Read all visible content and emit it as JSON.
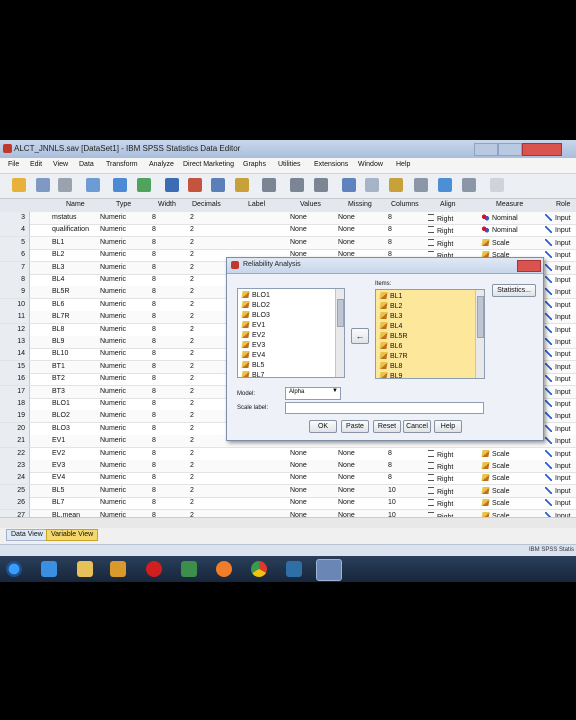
{
  "window": {
    "title": "ALCT_JNNLS.sav [DataSet1] - IBM SPSS Statistics Data Editor"
  },
  "menu": [
    "File",
    "Edit",
    "View",
    "Data",
    "Transform",
    "Analyze",
    "Direct Marketing",
    "Graphs",
    "Utilities",
    "Extensions",
    "Window",
    "Help"
  ],
  "grid": {
    "headers": {
      "name": "Name",
      "type": "Type",
      "width": "Width",
      "decimals": "Decimals",
      "label": "Label",
      "values": "Values",
      "missing": "Missing",
      "columns": "Columns",
      "align": "Align",
      "measure": "Measure",
      "role": "Role"
    },
    "rows": [
      {
        "n": "3",
        "name": "mstatus",
        "type": "Numeric",
        "width": "8",
        "dec": "2",
        "values": "None",
        "missing": "None",
        "columns": "8",
        "align": "Right",
        "measure": "Nominal",
        "role": "Input"
      },
      {
        "n": "4",
        "name": "qualification",
        "type": "Numeric",
        "width": "8",
        "dec": "2",
        "values": "None",
        "missing": "None",
        "columns": "8",
        "align": "Right",
        "measure": "Nominal",
        "role": "Input"
      },
      {
        "n": "5",
        "name": "BL1",
        "type": "Numeric",
        "width": "8",
        "dec": "2",
        "values": "None",
        "missing": "None",
        "columns": "8",
        "align": "Right",
        "measure": "Scale",
        "role": "Input"
      },
      {
        "n": "6",
        "name": "BL2",
        "type": "Numeric",
        "width": "8",
        "dec": "2",
        "values": "None",
        "missing": "None",
        "columns": "8",
        "align": "Right",
        "measure": "Scale",
        "role": "Input"
      },
      {
        "n": "7",
        "name": "BL3",
        "type": "Numeric",
        "width": "8",
        "dec": "2",
        "values": "",
        "missing": "",
        "columns": "",
        "align": "",
        "measure": "",
        "role": "Input"
      },
      {
        "n": "8",
        "name": "BL4",
        "type": "Numeric",
        "width": "8",
        "dec": "2",
        "values": "",
        "missing": "",
        "columns": "",
        "align": "",
        "measure": "",
        "role": "Input"
      },
      {
        "n": "9",
        "name": "BL5R",
        "type": "Numeric",
        "width": "8",
        "dec": "2",
        "values": "",
        "missing": "",
        "columns": "",
        "align": "",
        "measure": "",
        "role": "Input"
      },
      {
        "n": "10",
        "name": "BL6",
        "type": "Numeric",
        "width": "8",
        "dec": "2",
        "values": "",
        "missing": "",
        "columns": "",
        "align": "",
        "measure": "",
        "role": "Input"
      },
      {
        "n": "11",
        "name": "BL7R",
        "type": "Numeric",
        "width": "8",
        "dec": "2",
        "values": "",
        "missing": "",
        "columns": "",
        "align": "",
        "measure": "",
        "role": "Input"
      },
      {
        "n": "12",
        "name": "BL8",
        "type": "Numeric",
        "width": "8",
        "dec": "2",
        "values": "",
        "missing": "",
        "columns": "",
        "align": "",
        "measure": "",
        "role": "Input"
      },
      {
        "n": "13",
        "name": "BL9",
        "type": "Numeric",
        "width": "8",
        "dec": "2",
        "values": "",
        "missing": "",
        "columns": "",
        "align": "",
        "measure": "",
        "role": "Input"
      },
      {
        "n": "14",
        "name": "BL10",
        "type": "Numeric",
        "width": "8",
        "dec": "2",
        "values": "",
        "missing": "",
        "columns": "",
        "align": "",
        "measure": "",
        "role": "Input"
      },
      {
        "n": "15",
        "name": "BT1",
        "type": "Numeric",
        "width": "8",
        "dec": "2",
        "values": "",
        "missing": "",
        "columns": "",
        "align": "",
        "measure": "",
        "role": "Input"
      },
      {
        "n": "16",
        "name": "BT2",
        "type": "Numeric",
        "width": "8",
        "dec": "2",
        "values": "",
        "missing": "",
        "columns": "",
        "align": "",
        "measure": "",
        "role": "Input"
      },
      {
        "n": "17",
        "name": "BT3",
        "type": "Numeric",
        "width": "8",
        "dec": "2",
        "values": "",
        "missing": "",
        "columns": "",
        "align": "",
        "measure": "",
        "role": "Input"
      },
      {
        "n": "18",
        "name": "BLO1",
        "type": "Numeric",
        "width": "8",
        "dec": "2",
        "values": "",
        "missing": "",
        "columns": "",
        "align": "",
        "measure": "",
        "role": "Input"
      },
      {
        "n": "19",
        "name": "BLO2",
        "type": "Numeric",
        "width": "8",
        "dec": "2",
        "values": "",
        "missing": "",
        "columns": "",
        "align": "",
        "measure": "",
        "role": "Input"
      },
      {
        "n": "20",
        "name": "BLO3",
        "type": "Numeric",
        "width": "8",
        "dec": "2",
        "values": "",
        "missing": "",
        "columns": "",
        "align": "",
        "measure": "",
        "role": "Input"
      },
      {
        "n": "21",
        "name": "EV1",
        "type": "Numeric",
        "width": "8",
        "dec": "2",
        "values": "",
        "missing": "",
        "columns": "",
        "align": "",
        "measure": "",
        "role": "Input"
      },
      {
        "n": "22",
        "name": "EV2",
        "type": "Numeric",
        "width": "8",
        "dec": "2",
        "values": "None",
        "missing": "None",
        "columns": "8",
        "align": "Right",
        "measure": "Scale",
        "role": "Input"
      },
      {
        "n": "23",
        "name": "EV3",
        "type": "Numeric",
        "width": "8",
        "dec": "2",
        "values": "None",
        "missing": "None",
        "columns": "8",
        "align": "Right",
        "measure": "Scale",
        "role": "Input"
      },
      {
        "n": "24",
        "name": "EV4",
        "type": "Numeric",
        "width": "8",
        "dec": "2",
        "values": "None",
        "missing": "None",
        "columns": "8",
        "align": "Right",
        "measure": "Scale",
        "role": "Input"
      },
      {
        "n": "25",
        "name": "BL5",
        "type": "Numeric",
        "width": "8",
        "dec": "2",
        "values": "None",
        "missing": "None",
        "columns": "10",
        "align": "Right",
        "measure": "Scale",
        "role": "Input"
      },
      {
        "n": "26",
        "name": "BL7",
        "type": "Numeric",
        "width": "8",
        "dec": "2",
        "values": "None",
        "missing": "None",
        "columns": "10",
        "align": "Right",
        "measure": "Scale",
        "role": "Input"
      },
      {
        "n": "27",
        "name": "BL.mean",
        "type": "Numeric",
        "width": "8",
        "dec": "2",
        "values": "None",
        "missing": "None",
        "columns": "10",
        "align": "Right",
        "measure": "Scale",
        "role": "Input"
      }
    ]
  },
  "tabs": {
    "data_view": "Data View",
    "variable_view": "Variable View"
  },
  "status": "IBM SPSS Statis",
  "dialog": {
    "title": "Reliability Analysis",
    "source_items": [
      "BLO1",
      "BLO2",
      "BLO3",
      "EV1",
      "EV2",
      "EV3",
      "EV4",
      "BL5",
      "BL7"
    ],
    "items_label": "Items:",
    "selected_items": [
      "BL1",
      "BL2",
      "BL3",
      "BL4",
      "BL5R",
      "BL6",
      "BL7R",
      "BL8",
      "BL9"
    ],
    "statistics_button": "Statistics...",
    "model_label": "Model:",
    "model_value": "Alpha",
    "scale_label": "Scale label:",
    "scale_value": "",
    "buttons": {
      "ok": "OK",
      "paste": "Paste",
      "reset": "Reset",
      "cancel": "Cancel",
      "help": "Help"
    }
  },
  "colors": {
    "accent": "#f6d86a",
    "selection": "#fde79a",
    "dialog_bg": "#eef2f8"
  }
}
